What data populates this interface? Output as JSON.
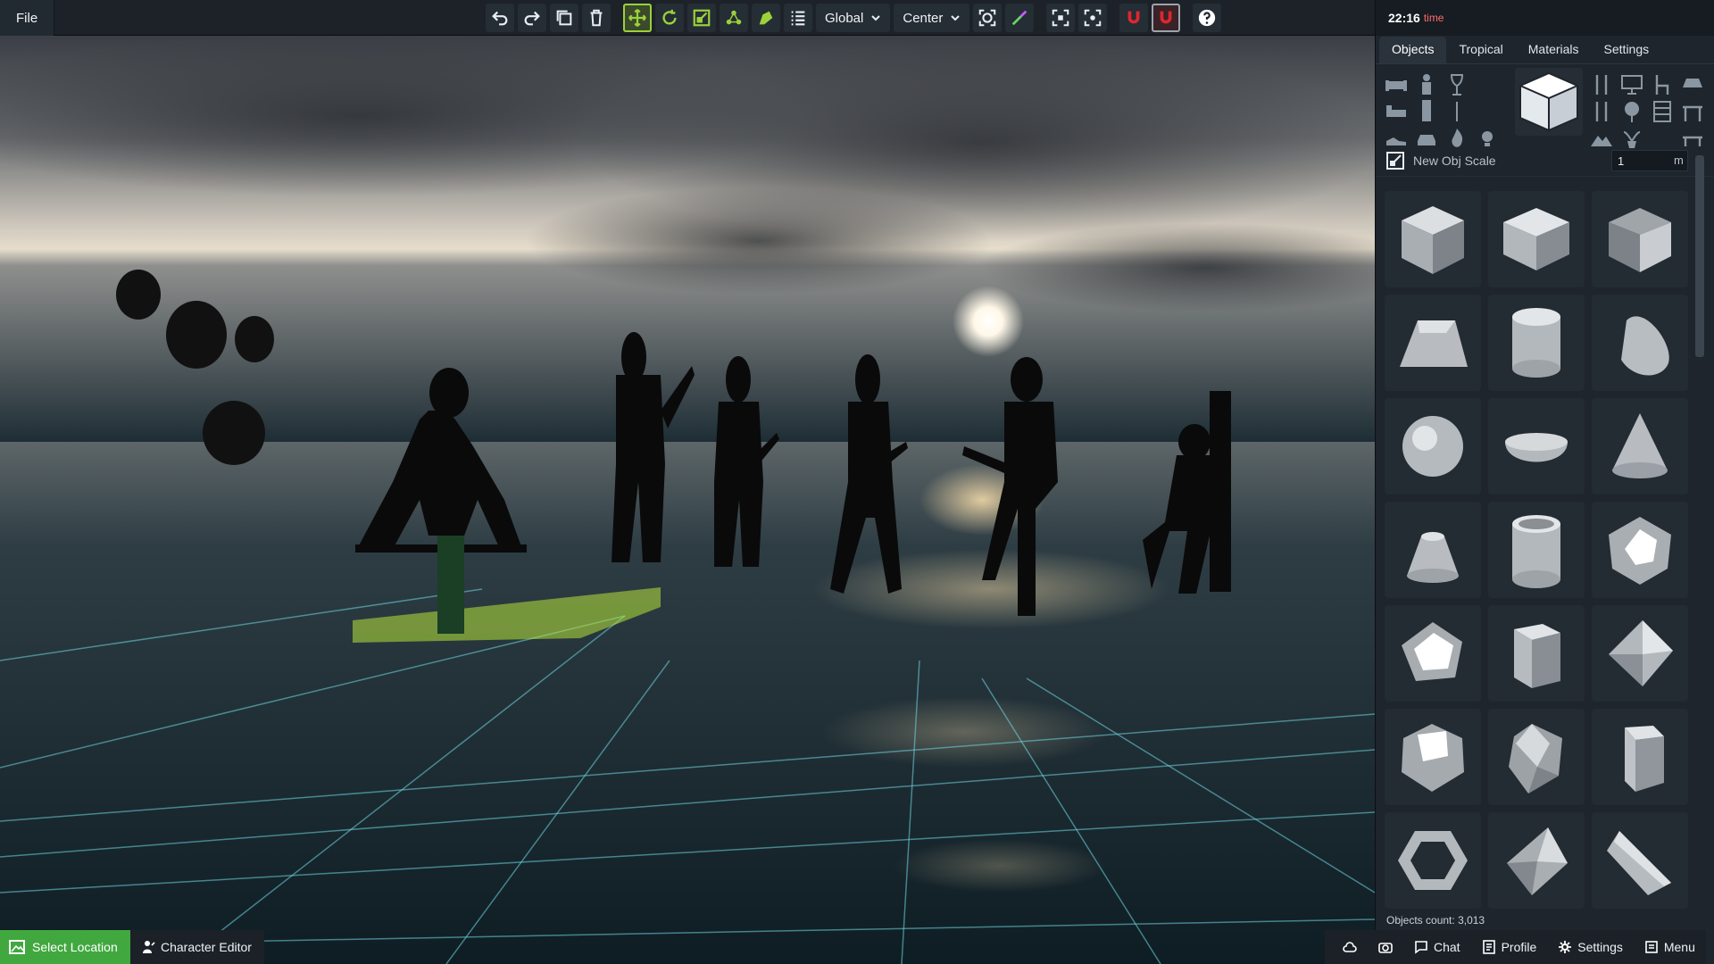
{
  "menu": {
    "file_label": "File"
  },
  "toolbar": {
    "buttons": [
      {
        "name": "undo-icon"
      },
      {
        "name": "redo-icon"
      },
      {
        "name": "duplicate-icon"
      },
      {
        "name": "trash-icon"
      },
      {
        "name": "move-tool-icon",
        "active": true
      },
      {
        "name": "rotate-tool-icon"
      },
      {
        "name": "scale-tool-icon"
      },
      {
        "name": "transform-tool-icon"
      },
      {
        "name": "paint-tool-icon"
      },
      {
        "name": "list-icon"
      }
    ],
    "space_dropdown": "Global",
    "pivot_dropdown": "Center",
    "colors": {
      "accent": "#9bd13a",
      "magnet": "#e0262f"
    }
  },
  "panel": {
    "time": {
      "value": "22:16",
      "label": "time"
    },
    "tabs": [
      "Objects",
      "Tropical",
      "Materials",
      "Settings"
    ],
    "active_tab": "Objects",
    "categories": [
      "sofa-icon",
      "person-icon",
      "wineglass-icon",
      "cube-icon",
      "cutlery-icon",
      "monitor-icon",
      "chair-icon",
      "car-table-icon",
      "bed-icon",
      "shoe-icon",
      "car-icon",
      "fire-icon",
      "lightbulb-icon",
      "fountain-icon",
      "mountain-icon",
      "plant-icon",
      "shelf-icon",
      "table-icon"
    ],
    "scale": {
      "label": "New Obj Scale",
      "value": "1",
      "unit": "m"
    },
    "objects": [
      "cube",
      "cube-angled",
      "cube-dark",
      "frustum",
      "cylinder",
      "capsule",
      "sphere",
      "hemisphere",
      "cone",
      "cone-truncated",
      "tube",
      "dodecahedron",
      "pentagonal-prism",
      "square-prism",
      "octahedron",
      "icosahedron",
      "faceted-gem",
      "hexagonal-prism",
      "hexagonal-ring",
      "tetrahedron",
      "wedge"
    ],
    "count_label": "Objects count:",
    "count_value": "3,013"
  },
  "bottombar": {
    "select_location": "Select Location",
    "character_editor": "Character Editor",
    "chat": "Chat",
    "profile": "Profile",
    "settings": "Settings",
    "menu": "Menu",
    "select_color": "#41a83f"
  }
}
